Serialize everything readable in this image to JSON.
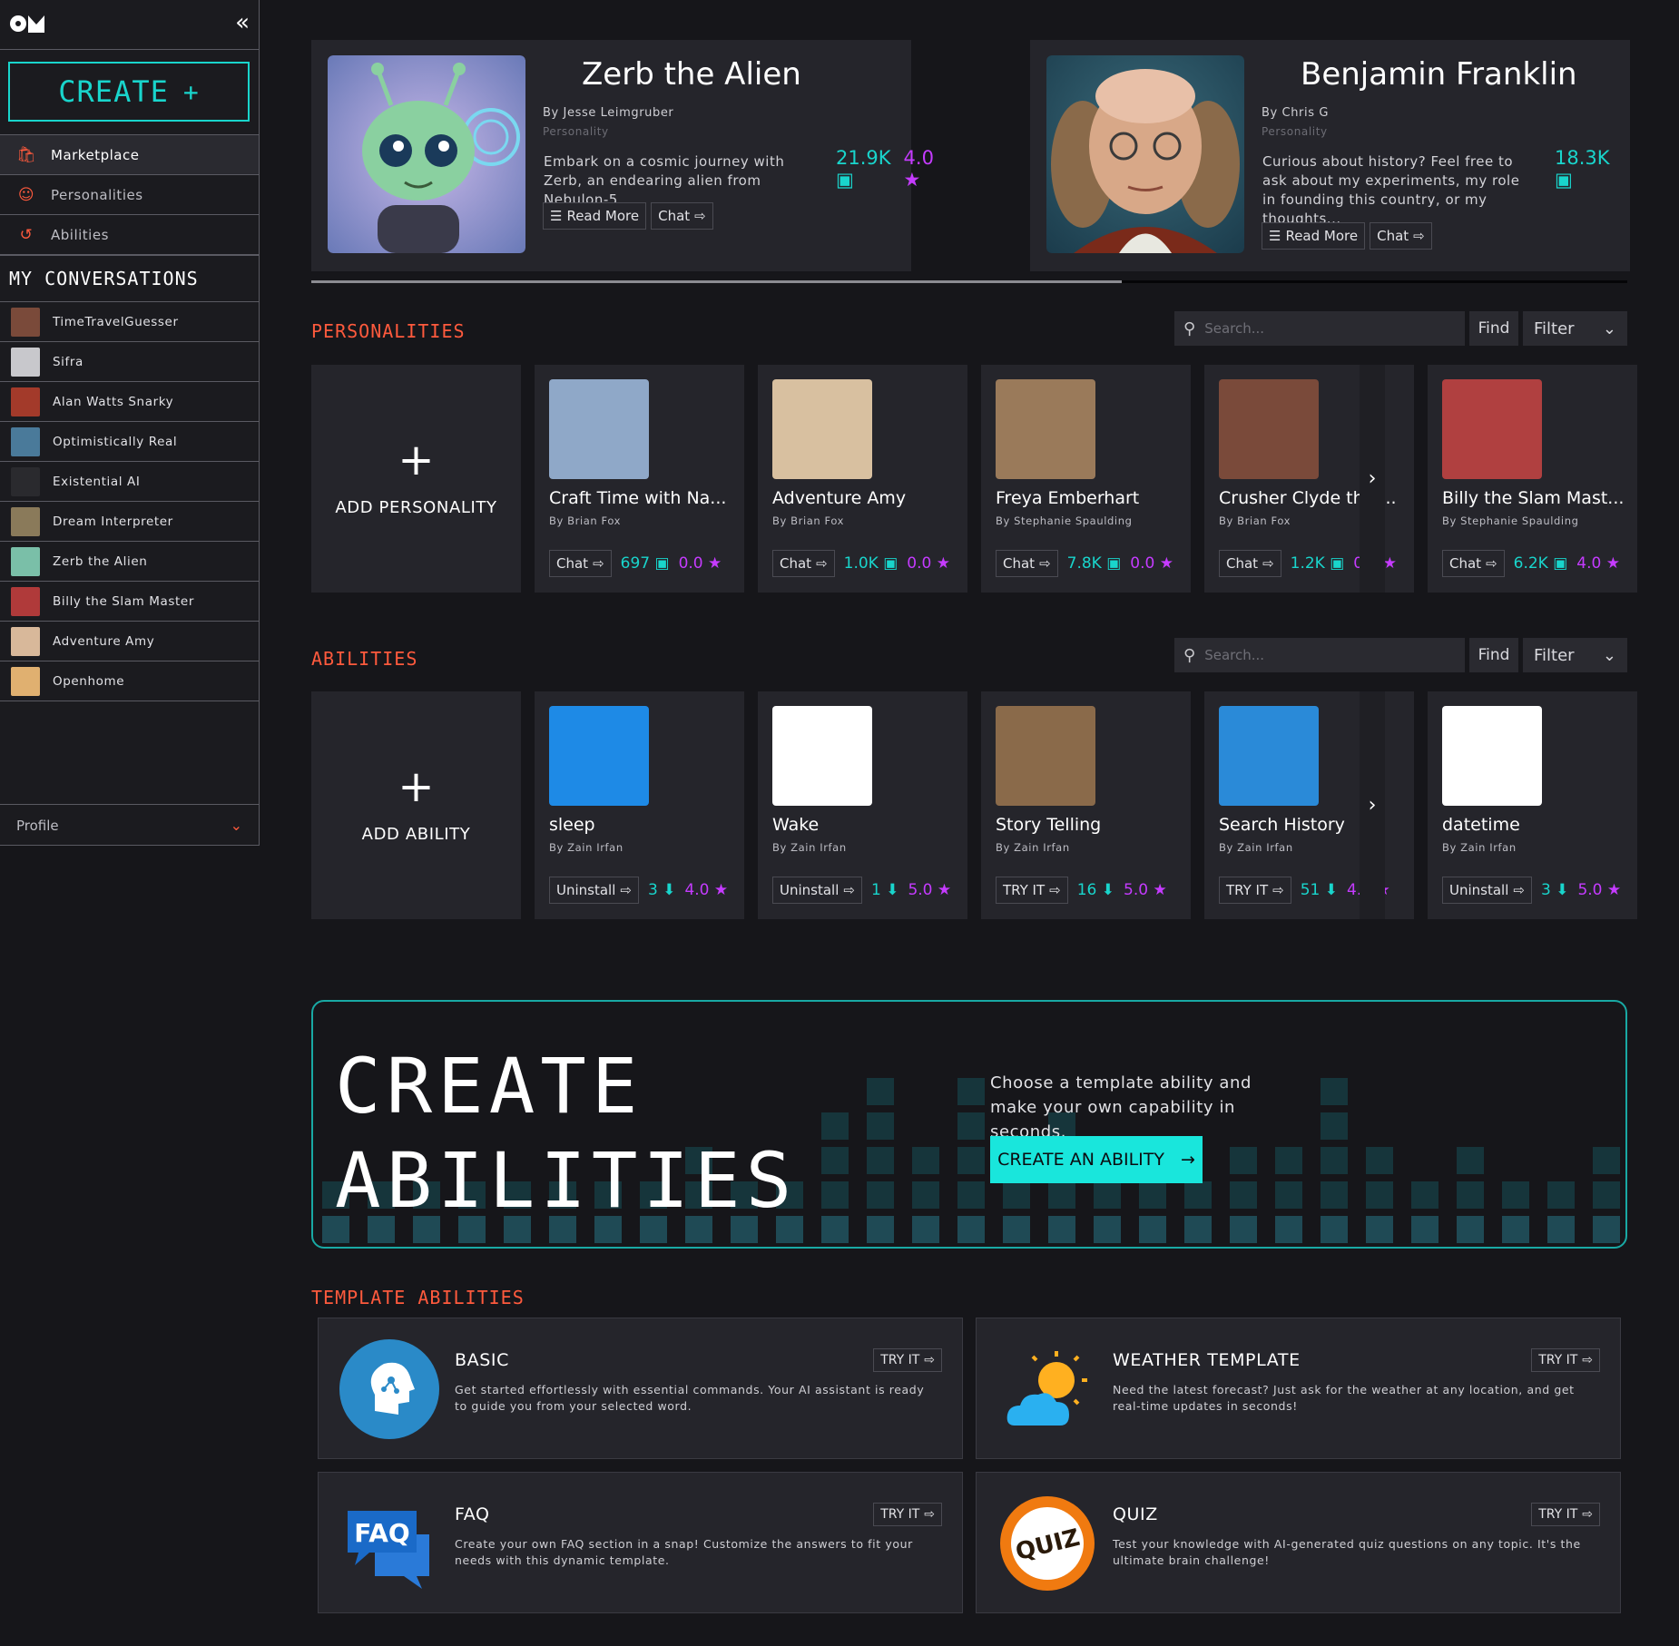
{
  "sidebar": {
    "create_label": "CREATE",
    "nav": [
      {
        "label": "Marketplace",
        "icon": "bag-icon"
      },
      {
        "label": "Personalities",
        "icon": "smiley-icon"
      },
      {
        "label": "Abilities",
        "icon": "ability-icon"
      }
    ],
    "conversations_title": "MY CONVERSATIONS",
    "conversations": [
      {
        "label": "TimeTravelGuesser",
        "color": "#7a4a3a"
      },
      {
        "label": "Sifra",
        "color": "#c8c8cc"
      },
      {
        "label": "Alan Watts Snarky",
        "color": "#a33a2a"
      },
      {
        "label": "Optimistically Real",
        "color": "#4a7a9a"
      },
      {
        "label": "Existential AI",
        "color": "#2a2a2e"
      },
      {
        "label": "Dream Interpreter",
        "color": "#8a7a5a"
      },
      {
        "label": "Zerb the Alien",
        "color": "#7abfa8"
      },
      {
        "label": "Billy the Slam Master",
        "color": "#b03a3a"
      },
      {
        "label": "Adventure Amy",
        "color": "#d8b89a"
      },
      {
        "label": "Openhome",
        "color": "#e0b070"
      }
    ],
    "profile_label": "Profile"
  },
  "featured": [
    {
      "title": "Zerb the Alien",
      "by": "By Jesse Leimgruber",
      "category": "Personality",
      "description": "Embark on a cosmic journey with Zerb, an endearing alien from Nebulon-5",
      "chats": "21.9K",
      "rating": "4.0",
      "read_more": "Read More",
      "chat": "Chat"
    },
    {
      "title": "Benjamin Franklin",
      "by": "By Chris G",
      "category": "Personality",
      "description": "Curious about history? Feel free to ask about my experiments, my role in founding this country, or my thoughts...",
      "chats": "18.3K",
      "read_more": "Read More",
      "chat": "Chat"
    }
  ],
  "personalities": {
    "title": "PERSONALITIES",
    "search_placeholder": "Search...",
    "find": "Find",
    "filter": "Filter",
    "add_label": "ADD PERSONALITY",
    "cards": [
      {
        "name": "Craft Time with Na...",
        "by": "By Brian Fox",
        "btn": "Chat",
        "count": "697",
        "rating": "0.0",
        "color": "#8fa8c8"
      },
      {
        "name": "Adventure Amy",
        "by": "By Brian Fox",
        "btn": "Chat",
        "count": "1.0K",
        "rating": "0.0",
        "color": "#d8c0a0"
      },
      {
        "name": "Freya Emberhart",
        "by": "By Stephanie Spaulding",
        "btn": "Chat",
        "count": "7.8K",
        "rating": "0.0",
        "color": "#9a7a5a"
      },
      {
        "name": "Crusher Clyde the ...",
        "by": "By Brian Fox",
        "btn": "Chat",
        "count": "1.2K",
        "rating": "0.0",
        "color": "#7a4a3a"
      },
      {
        "name": "Billy the Slam Mast...",
        "by": "By Stephanie Spaulding",
        "btn": "Chat",
        "count": "6.2K",
        "rating": "4.0",
        "color": "#b04040"
      }
    ]
  },
  "abilities": {
    "title": "ABILITIES",
    "search_placeholder": "Search...",
    "find": "Find",
    "filter": "Filter",
    "add_label": "ADD ABILITY",
    "cards": [
      {
        "name": "sleep",
        "by": "By Zain Irfan",
        "btn": "Uninstall",
        "count": "3",
        "rating": "4.0",
        "color": "#1e8ae6"
      },
      {
        "name": "Wake",
        "by": "By Zain Irfan",
        "btn": "Uninstall",
        "count": "1",
        "rating": "5.0",
        "color": "#ffffff"
      },
      {
        "name": "Story Telling",
        "by": "By Zain Irfan",
        "btn": "TRY IT",
        "count": "16",
        "rating": "5.0",
        "color": "#8a6a4a"
      },
      {
        "name": "Search History",
        "by": "By Zain Irfan",
        "btn": "TRY IT",
        "count": "51",
        "rating": "4.0",
        "color": "#2a8ad8"
      },
      {
        "name": "datetime",
        "by": "By Zain Irfan",
        "btn": "Uninstall",
        "count": "3",
        "rating": "5.0",
        "color": "#ffffff"
      }
    ]
  },
  "banner": {
    "line1": "CREATE",
    "line2": "ABILITIES",
    "text": "Choose a template ability and make your own capability in seconds.",
    "cta": "CREATE AN ABILITY"
  },
  "templates": {
    "title": "TEMPLATE ABILITIES",
    "items": [
      {
        "title": "BASIC",
        "desc": "Get started effortlessly with essential commands. Your AI assistant is ready to guide you from your selected word.",
        "try": "TRY IT"
      },
      {
        "title": "WEATHER TEMPLATE",
        "desc": "Need the latest forecast? Just ask for the weather at any location, and get real-time updates in seconds!",
        "try": "TRY IT"
      },
      {
        "title": "FAQ",
        "desc": "Create your own FAQ section in a snap! Customize the answers to fit your needs with this dynamic template.",
        "try": "TRY IT"
      },
      {
        "title": "QUIZ",
        "desc": "Test your knowledge with AI-generated quiz questions on any topic. It's the ultimate brain challenge!",
        "try": "TRY IT"
      }
    ]
  },
  "colors": {
    "accent": "#19d5cc",
    "orange": "#ff5a3d",
    "magenta": "#c53bff",
    "surface": "#25252b"
  }
}
